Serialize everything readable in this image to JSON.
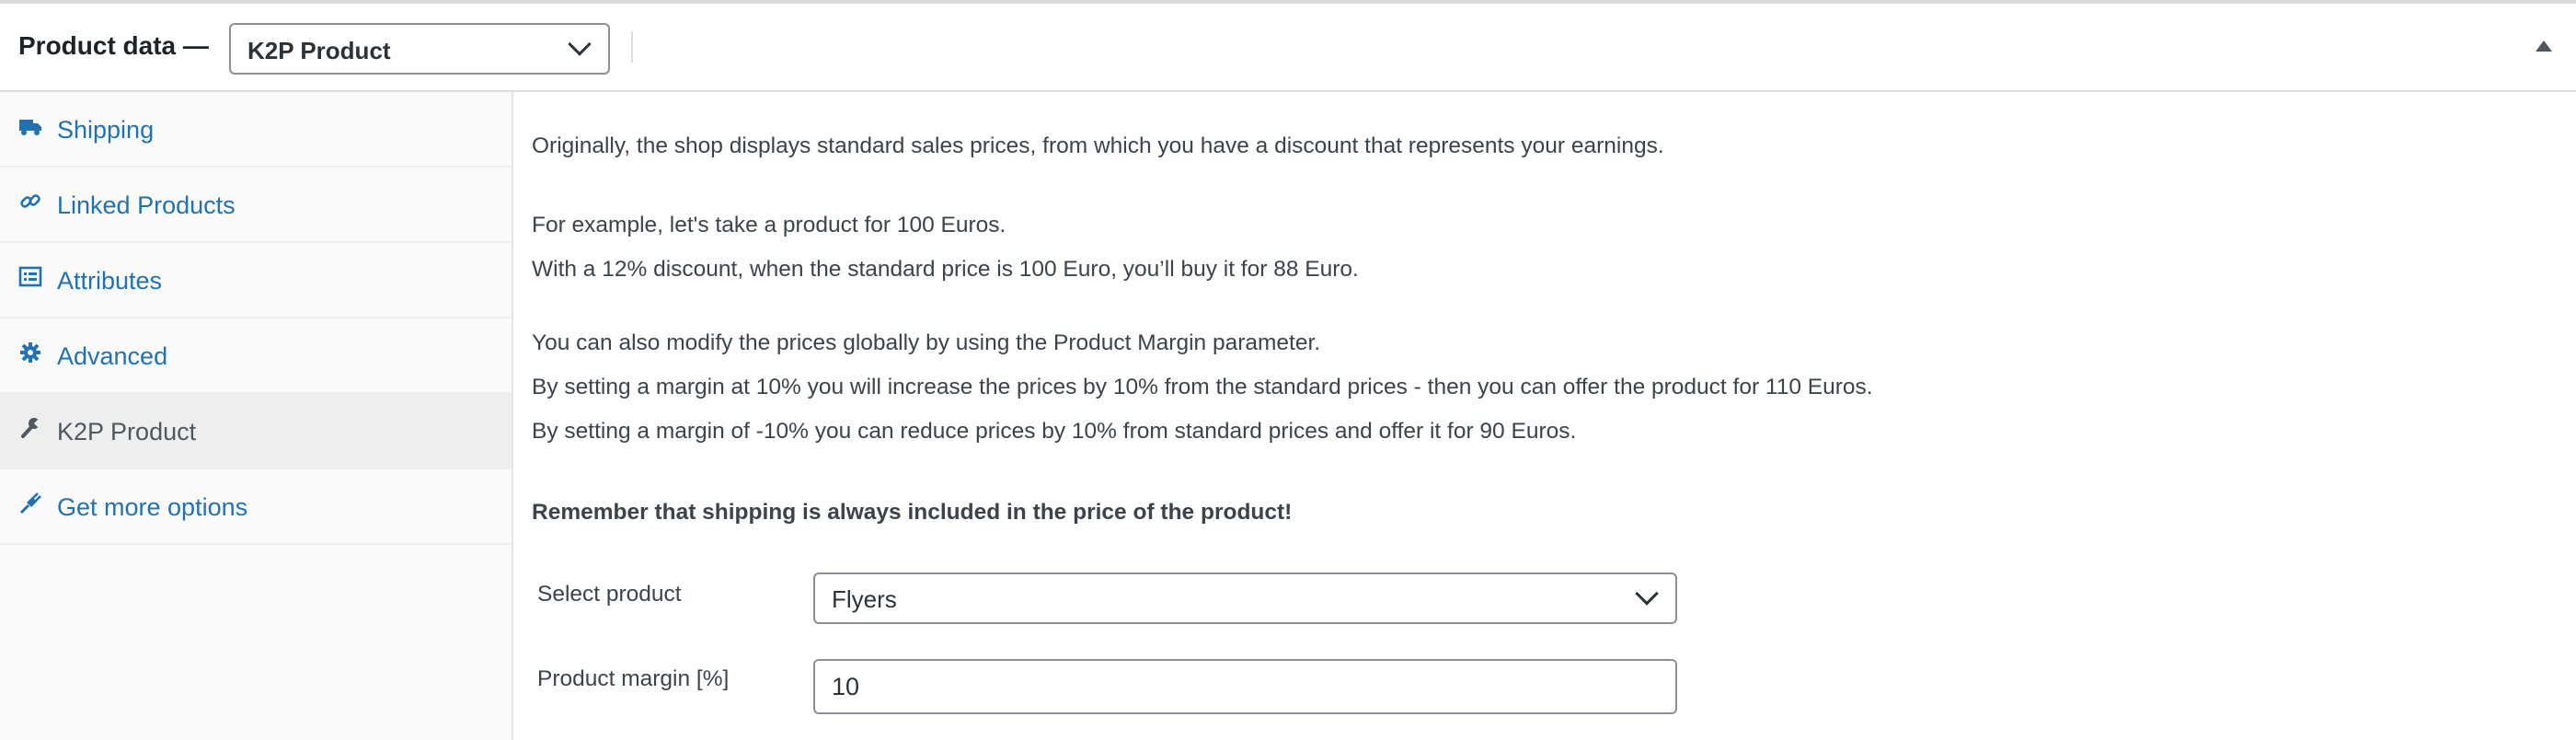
{
  "header": {
    "title": "Product data —",
    "product_type": "K2P Product"
  },
  "sidebar": {
    "tabs": [
      {
        "label": "Shipping",
        "icon": "truck-icon"
      },
      {
        "label": "Linked Products",
        "icon": "link-icon"
      },
      {
        "label": "Attributes",
        "icon": "list-icon"
      },
      {
        "label": "Advanced",
        "icon": "gear-icon"
      },
      {
        "label": "K2P Product",
        "icon": "wrench-icon",
        "active": true
      },
      {
        "label": "Get more options",
        "icon": "plug-icon"
      }
    ]
  },
  "main": {
    "para1": "Originally, the shop displays standard sales prices, from which you have a discount that represents your earnings.",
    "para2": "For example, let's take a product for 100 Euros.",
    "para3": "With a 12% discount, when the standard price is 100 Euro, you’ll buy it for 88 Euro.",
    "para4": "You can also modify the prices globally by using the Product Margin parameter.",
    "para5": "By setting a margin at 10% you will increase the prices by 10% from the standard prices - then you can offer the product for 110 Euros.",
    "para6": "By setting a margin of -10% you can reduce prices by 10% from standard prices and offer it for 90 Euros.",
    "notice": "Remember that shipping is always included in the price of the product!",
    "select_product": {
      "label": "Select product",
      "value": "Flyers"
    },
    "product_margin": {
      "label": "Product margin [%]",
      "value": "10"
    }
  },
  "colors": {
    "link": "#2271b1",
    "text": "#3c434a",
    "border": "#8c8f94",
    "sidebar_bg": "#fafafa",
    "active_tab_bg": "#eeeeee"
  }
}
